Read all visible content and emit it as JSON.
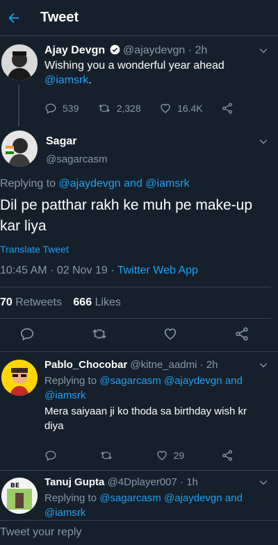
{
  "header": {
    "title": "Tweet"
  },
  "tweet1": {
    "name": "Ajay Devgn",
    "handle": "@ajaydevgn",
    "sep": "·",
    "time": "2h",
    "text": "Wishing you a wonderful year ahead",
    "mention": "@iamsrk",
    "period": ".",
    "replies": "539",
    "retweets": "2,328",
    "likes": "16.4K"
  },
  "main": {
    "name": "Sagar",
    "handle": "@sagarcasm",
    "replying_prefix": "Replying to",
    "replying_1": "@ajaydevgn",
    "replying_and": "and",
    "replying_2": "@iamsrk",
    "text": "Dil pe patthar rakh ke muh pe make-up kar liya",
    "translate": "Translate Tweet",
    "time": "10:45 AM · 02 Nov 19 ·",
    "app": "Twitter Web App",
    "retweets_count": "70",
    "retweets_label": "Retweets",
    "likes_count": "666",
    "likes_label": "Likes"
  },
  "reply1": {
    "name": "Pablo_Chocobar",
    "handle": "@kitne_aadmi",
    "sep": "·",
    "time": "2h",
    "replying_prefix": "Replying to",
    "replying_1": "@sagarcasm",
    "replying_2": "@ajaydevgn",
    "replying_and": "and",
    "replying_3": "@iamsrk",
    "text": "Mera saiyaan ji ko thoda sa birthday wish kr diya",
    "likes": "29"
  },
  "reply2": {
    "name": "Tanuj Gupta",
    "handle": "@4Dplayer007",
    "sep": "·",
    "time": "1h",
    "replying_prefix": "Replying to",
    "replying_1": "@sagarcasm",
    "replying_2": "@ajaydevgn",
    "replying_and": "and",
    "replying_3": "@iamsrk",
    "avatar_text": "BE"
  },
  "reply_bar": {
    "placeholder": "Tweet your reply"
  },
  "colors": {
    "background": "#15202b",
    "accent": "#1da1f2",
    "muted": "#8899a6",
    "divider": "#38444d"
  }
}
